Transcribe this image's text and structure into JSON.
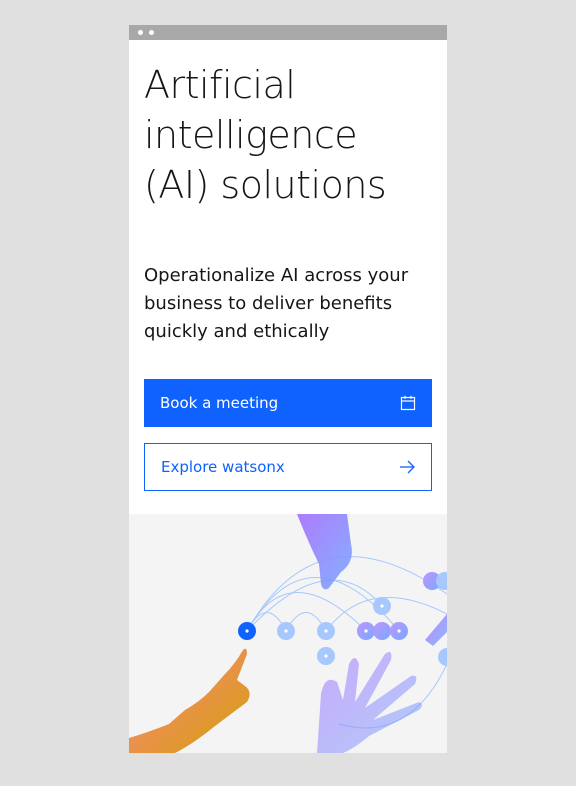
{
  "hero": {
    "title": "Artificial intelligence (AI) solutions",
    "subtitle": "Operationalize AI across your business to deliver benefits quickly and ethically"
  },
  "actions": {
    "primary_label": "Book a meeting",
    "primary_icon": "calendar-icon",
    "secondary_label": "Explore watsonx",
    "secondary_icon": "arrow-right-icon"
  },
  "colors": {
    "brand_blue": "#0f62fe",
    "text": "#161616",
    "page_bg": "#e0e0e0",
    "illustration_bg": "#f4f4f4"
  }
}
